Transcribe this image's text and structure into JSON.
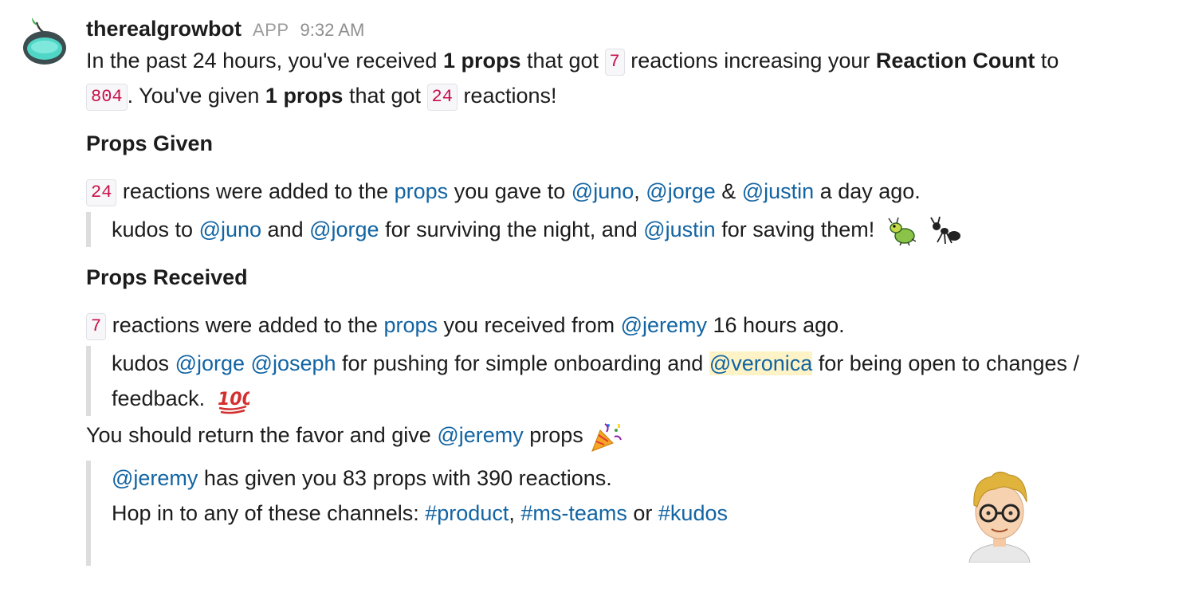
{
  "message": {
    "sender": "therealgrowbot",
    "badge": "APP",
    "time": "9:32 AM",
    "avatar_icon": "growbot-icon",
    "summary": {
      "t1": "In the past 24 hours, you've received ",
      "b1": "1 props",
      "t2": " that got ",
      "c1": "7",
      "t3": " reactions increasing your ",
      "b2": "Reaction Count",
      "t4": " to ",
      "c2": "804",
      "t5": ". You've given ",
      "b3": "1 props",
      "t6": " that got ",
      "c3": "24",
      "t7": " reactions!"
    },
    "props_given": {
      "title": "Props Given",
      "count": "24",
      "t1": " reactions were added to the ",
      "link": "props",
      "t2": " you gave to  ",
      "m1": "@juno",
      "sep1": ", ",
      "m2": "@jorge",
      "sep2": " & ",
      "m3": "@justin",
      "t3": " a day ago.",
      "quote": {
        "t1": "kudos to ",
        "m1": "@juno",
        "t2": " and ",
        "m2": "@jorge",
        "t3": " for surviving the night, and ",
        "m3": "@justin",
        "t4": " for saving them! ",
        "emoji1": "bug-icon",
        "emoji2": "ant-icon"
      }
    },
    "props_received": {
      "title": "Props Received",
      "count": "7",
      "t1": " reactions were added to the ",
      "link": "props",
      "t2": " you received from ",
      "m1": "@jeremy",
      "t3": " 16 hours ago.",
      "quote": {
        "t1": "kudos ",
        "m1": "@jorge",
        "t2": " ",
        "m2": "@joseph",
        "t3": " for pushing for simple onboarding and ",
        "m3": "@veronica",
        "t4": " for being open to changes / feedback. ",
        "emoji": "hundred-points-icon"
      }
    },
    "return_favor": {
      "t1": "You should return the favor and give ",
      "m1": "@jeremy",
      "t2": " props",
      "emoji": "party-popper-icon"
    },
    "attachment": {
      "m1": "@jeremy",
      "t1": " has given you 83 props with 390 reactions.",
      "t2": "Hop in to any of these channels: ",
      "ch1": "#product",
      "sep1": ", ",
      "ch2": "#ms-teams",
      "sep2": " or ",
      "ch3": "#kudos",
      "image_icon": "bitmoji-avatar-icon"
    }
  },
  "colors": {
    "mention": "#1264a3",
    "code_text": "#c8104a",
    "quote_bar": "#dddddd",
    "highlight": "#fdf3c6"
  }
}
